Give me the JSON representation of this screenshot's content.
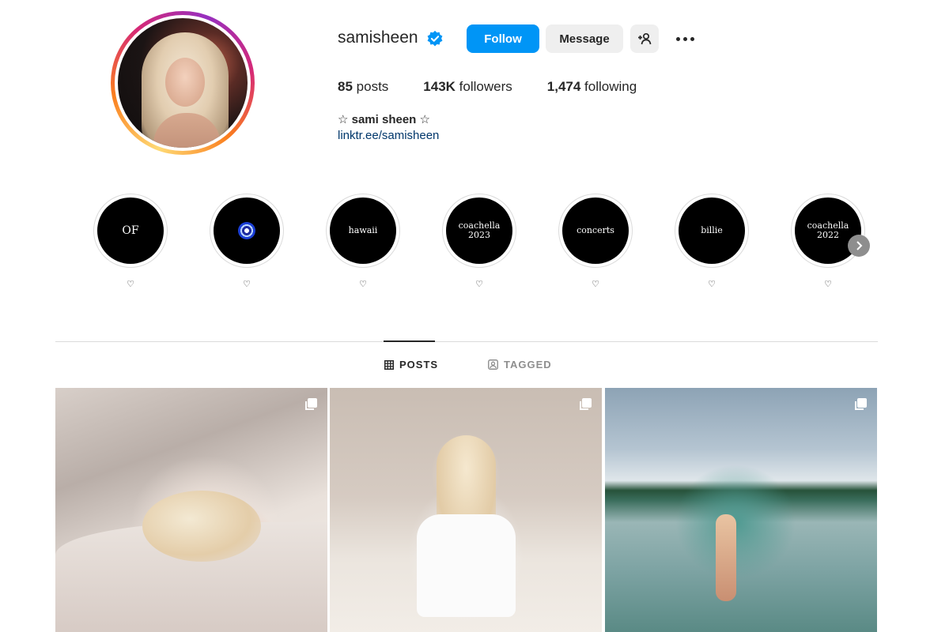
{
  "profile": {
    "username": "samisheen",
    "full_name": "☆ sami sheen ☆",
    "bio_link": "linktr.ee/samisheen"
  },
  "actions": {
    "follow_label": "Follow",
    "message_label": "Message"
  },
  "stats": {
    "posts_count": "85",
    "posts_label": "posts",
    "followers_count": "143K",
    "followers_label": "followers",
    "following_count": "1,474",
    "following_label": "following"
  },
  "highlights": [
    {
      "title": "OF",
      "label": "♡"
    },
    {
      "title": "",
      "label": "♡",
      "icon": "evil-eye-icon"
    },
    {
      "title": "hawaii",
      "label": "♡"
    },
    {
      "title": "coachella\n2023",
      "label": "♡"
    },
    {
      "title": "concerts",
      "label": "♡"
    },
    {
      "title": "billie",
      "label": "♡"
    },
    {
      "title": "coachella\n2022",
      "label": "♡"
    }
  ],
  "tabs": {
    "posts": "POSTS",
    "tagged": "TAGGED"
  },
  "colors": {
    "accent": "#0095f6",
    "link": "#00376b",
    "text": "#262626"
  }
}
